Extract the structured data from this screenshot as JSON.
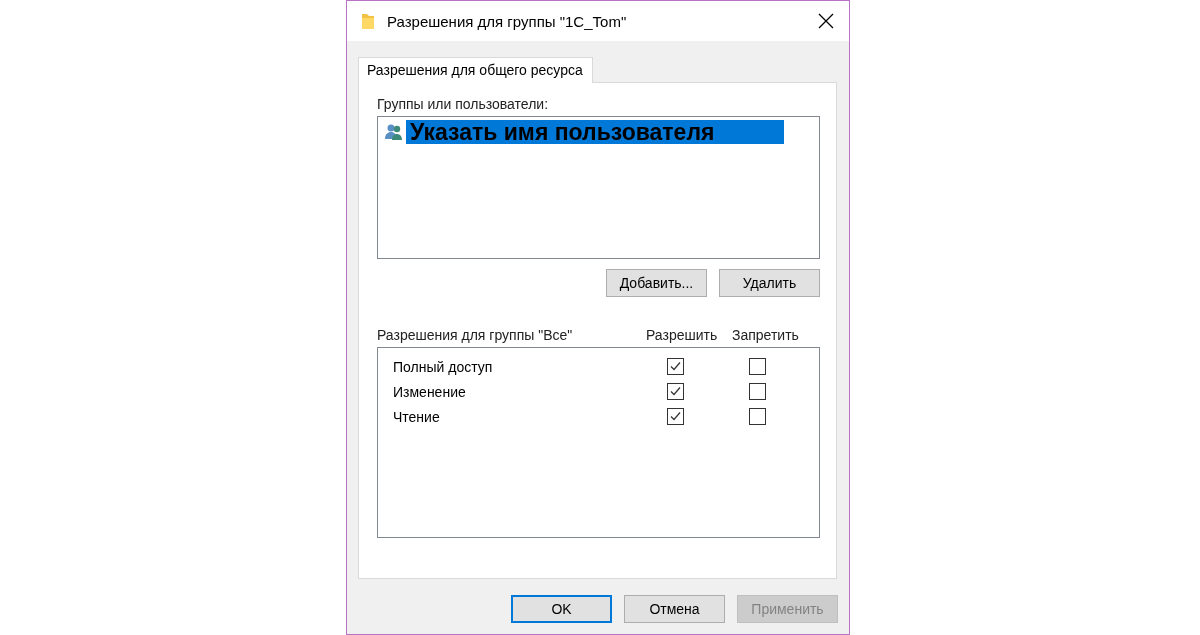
{
  "window": {
    "title": "Разрешения для группы \"1C_Tom\""
  },
  "tabs": [
    {
      "label": "Разрешения для общего ресурса",
      "selected": true
    }
  ],
  "groups": {
    "label": "Группы или пользователи:",
    "items": [
      {
        "label": "Указать имя пользователя",
        "selected": true
      }
    ],
    "buttons": [
      {
        "label": "Добавить..."
      },
      {
        "label": "Удалить"
      }
    ]
  },
  "permissions": {
    "label": "Разрешения для группы \"Все\"",
    "columns": [
      "Разрешить",
      "Запретить"
    ],
    "rows": [
      {
        "name": "Полный доступ",
        "allow": true,
        "deny": false
      },
      {
        "name": "Изменение",
        "allow": true,
        "deny": false
      },
      {
        "name": "Чтение",
        "allow": true,
        "deny": false
      }
    ]
  },
  "buttons": [
    {
      "label": "OK",
      "default": true,
      "disabled": false
    },
    {
      "label": "Отмена",
      "default": false,
      "disabled": false
    },
    {
      "label": "Применить",
      "default": false,
      "disabled": true
    }
  ]
}
